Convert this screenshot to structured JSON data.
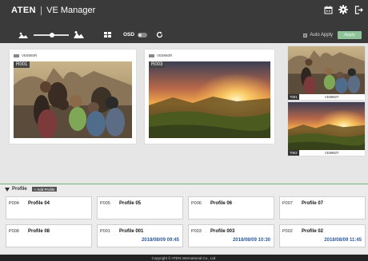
{
  "header": {
    "brand": "ATEN",
    "app_title": "VE Manager",
    "icons": [
      "calendar-icon",
      "gear-icon",
      "logout-icon"
    ]
  },
  "toolbar": {
    "osd_label": "OSD",
    "osd_on": false,
    "auto_apply_label": "Auto Apply",
    "auto_apply_checked": false,
    "apply_label": "Apply"
  },
  "colors": {
    "header_bg": "#3a3a3a",
    "accent": "#6fb07a",
    "date_blue": "#2c5aa0"
  },
  "sources": [
    {
      "device": "VE8950R",
      "label": "R001",
      "image": "family-photo"
    },
    {
      "device": "VE8950R",
      "label": "R003",
      "image": "sunset-landscape"
    }
  ],
  "previews": [
    {
      "tag": "T001",
      "device": "VE8950T",
      "image": "family-photo"
    },
    {
      "tag": "T002",
      "device": "VE8950T",
      "image": "sunset-landscape"
    }
  ],
  "profile": {
    "title": "Profile",
    "add_label": "+ Add Profile",
    "items": [
      {
        "id": "P004",
        "name": "Profile 04",
        "date": ""
      },
      {
        "id": "P005",
        "name": "Profile 05",
        "date": ""
      },
      {
        "id": "P006",
        "name": "Profile 06",
        "date": ""
      },
      {
        "id": "P007",
        "name": "Profile 07",
        "date": ""
      },
      {
        "id": "P008",
        "name": "Profile 08",
        "date": ""
      },
      {
        "id": "P001",
        "name": "Profile 001",
        "date": "2018/08/09 09:45"
      },
      {
        "id": "P003",
        "name": "Profile 003",
        "date": "2018/08/09 10:30"
      },
      {
        "id": "P002",
        "name": "Profile 02",
        "date": "2018/08/09 11:45"
      }
    ]
  },
  "footer": "Copyright © ATEN International Co., Ltd."
}
